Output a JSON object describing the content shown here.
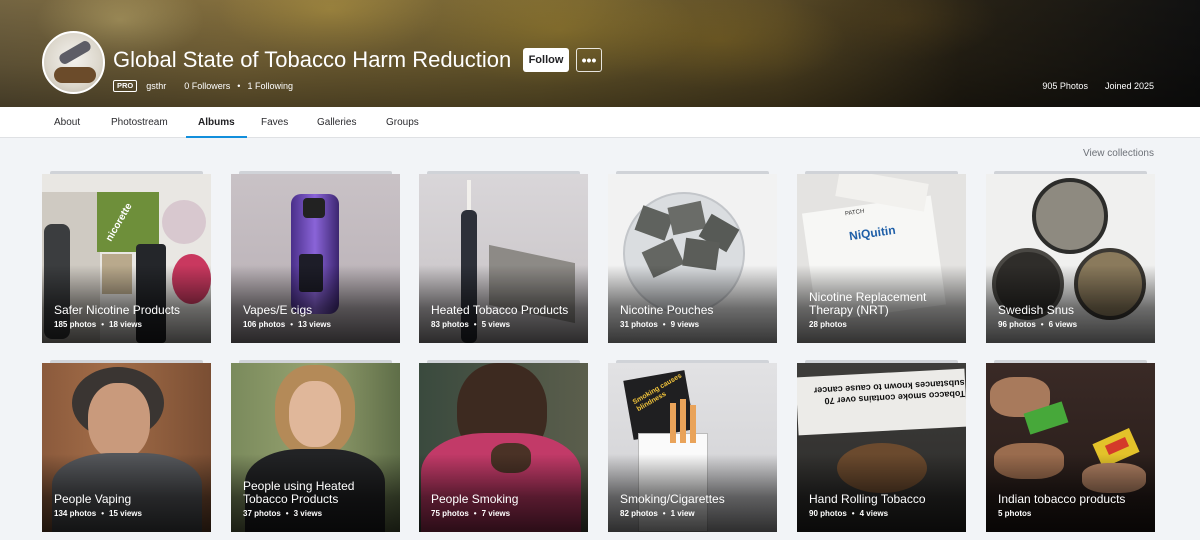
{
  "profile": {
    "name": "Global State of Tobacco Harm Reduction",
    "follow_label": "Follow",
    "more_label": "•••",
    "pro_badge": "PRO",
    "username": "gsthr",
    "followers": "0 Followers",
    "following": "1 Following",
    "separator": "•",
    "photos_count": "905 Photos",
    "joined": "Joined 2025"
  },
  "tabs": [
    "About",
    "Photostream",
    "Albums",
    "Faves",
    "Galleries",
    "Groups"
  ],
  "active_tab": "Albums",
  "view_collections": "View collections",
  "albums": [
    {
      "title": "Safer Nicotine Products",
      "photos": "185 photos",
      "views": "18 views"
    },
    {
      "title": "Vapes/E cigs",
      "photos": "106 photos",
      "views": "13 views"
    },
    {
      "title": "Heated Tobacco Products",
      "photos": "83 photos",
      "views": "5 views"
    },
    {
      "title": "Nicotine Pouches",
      "photos": "31 photos",
      "views": "9 views"
    },
    {
      "title": "Nicotine Replacement Therapy (NRT)",
      "photos": "28 photos",
      "views": ""
    },
    {
      "title": "Swedish Snus",
      "photos": "96 photos",
      "views": "6 views"
    },
    {
      "title": "People Vaping",
      "photos": "134 photos",
      "views": "15 views"
    },
    {
      "title": "People using Heated Tobacco Products",
      "photos": "37 photos",
      "views": "3 views"
    },
    {
      "title": "People Smoking",
      "photos": "75 photos",
      "views": "7 views"
    },
    {
      "title": "Smoking/Cigarettes",
      "photos": "82 photos",
      "views": "1 view"
    },
    {
      "title": "Hand Rolling Tobacco",
      "photos": "90 photos",
      "views": "4 views"
    },
    {
      "title": "Indian tobacco products",
      "photos": "5 photos",
      "views": ""
    }
  ],
  "image_text": {
    "nicorette": "nicorette",
    "niquitin": "NiQuitin",
    "patch": "PATCH",
    "pack_warning": "Smoking causes blindness",
    "rolling_warning": "Tobacco smoke contains over 70 substances known to cause cancer"
  },
  "colors": {
    "accent": "#128fdc",
    "background": "#f2f4f7"
  }
}
